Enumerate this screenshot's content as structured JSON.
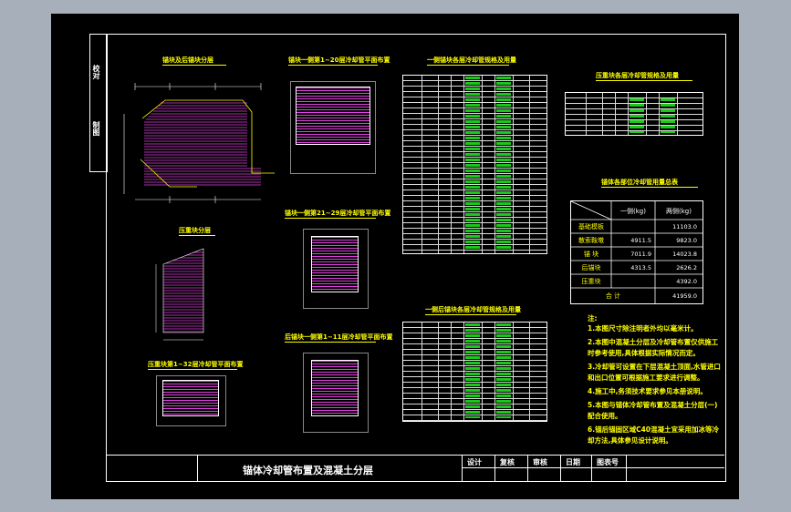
{
  "drawing": {
    "title": "锚体冷却管布置及混凝土分层",
    "left_stamp_top": "校对",
    "left_stamp_bottom": "制图"
  },
  "views": {
    "anchor_layers": "锚块及后锚块分层",
    "anchor_pipe_1_20": "锚块一侧第1~20层冷却管平面布置",
    "pressure_block_layers": "压重块分层",
    "anchor_pipe_21_29": "锚块一侧第21~29层冷却管平面布置",
    "rear_anchor_pipe_1_11": "后锚块一侧第1~11层冷却管平面布置",
    "pressure_pipe_1_32": "压重块第1~32层冷却管平面布置"
  },
  "tables": {
    "anchor_pipe_spec": "一侧锚块各层冷却管规格及用量",
    "rear_anchor_pipe_spec": "一侧后锚块各层冷却管规格及用量",
    "pressure_pipe_spec": "压重块各层冷却管规格及用量"
  },
  "summary": {
    "title": "锚体各部位冷却管用量总表",
    "col_headers": [
      "",
      "一侧(kg)",
      "两侧(kg)"
    ],
    "rows": [
      {
        "name": "基础模板",
        "one": "",
        "two": "11103.0"
      },
      {
        "name": "散索鞍墩",
        "one": "4911.5",
        "two": "9823.0"
      },
      {
        "name": "锚 块",
        "one": "7011.9",
        "two": "14023.8"
      },
      {
        "name": "后锚块",
        "one": "4313.5",
        "two": "2626.2"
      },
      {
        "name": "压重块",
        "one": "",
        "two": "4392.0"
      }
    ],
    "total_label": "合 计",
    "total_value": "41959.0"
  },
  "notes": {
    "heading": "注:",
    "lines": [
      "1.本图尺寸除注明者外均以毫米计。",
      "2.本图中混凝土分层及冷却管布置仅供施工",
      "   时参考使用,具体根据实际情况而定。",
      "3.冷却管可设置在下层混凝土顶面,水管进口",
      "   和出口位置可根据施工要求进行调整。",
      "4.施工中,务须技术要求参见本册说明。",
      "5.本图与锚体冷却管布置及混凝土分层(一)",
      "   配合使用。",
      "6.锚后锚固区域C40混凝土宜采用加冰等冷",
      "   却方法,具体参见设计说明。"
    ]
  },
  "title_block": {
    "design": "设计",
    "review": "复核",
    "audit": "审核",
    "date": "日期",
    "drawing_no": "图表号"
  },
  "colors": {
    "background": "#a7b0ba",
    "sheet": "#000000",
    "title_text": "#ffff00",
    "hatch": "#e041e0",
    "table_fill": "#19c919",
    "line": "#ffffff"
  }
}
